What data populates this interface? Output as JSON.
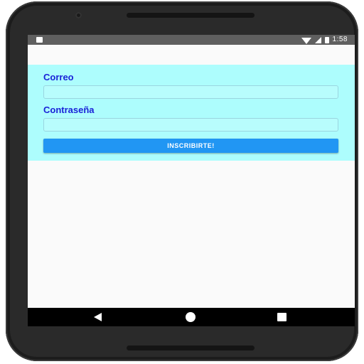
{
  "status_bar": {
    "time": "1:58",
    "icons": [
      "notification-icon",
      "wifi-icon",
      "signal-icon",
      "battery-icon"
    ]
  },
  "form": {
    "email_label": "Correo",
    "email_value": "",
    "password_label": "Contraseña",
    "password_value": "",
    "submit_label": "INSCRIBIRTE!"
  },
  "nav_bar": {
    "icons": [
      "back-icon",
      "home-icon",
      "recent-apps-icon"
    ]
  },
  "colors": {
    "panel_background": "#adfdfd",
    "label_color": "#1a22d8",
    "button_color": "#2196f3",
    "status_bar": "#5f5f5f",
    "nav_bar": "#000000"
  }
}
